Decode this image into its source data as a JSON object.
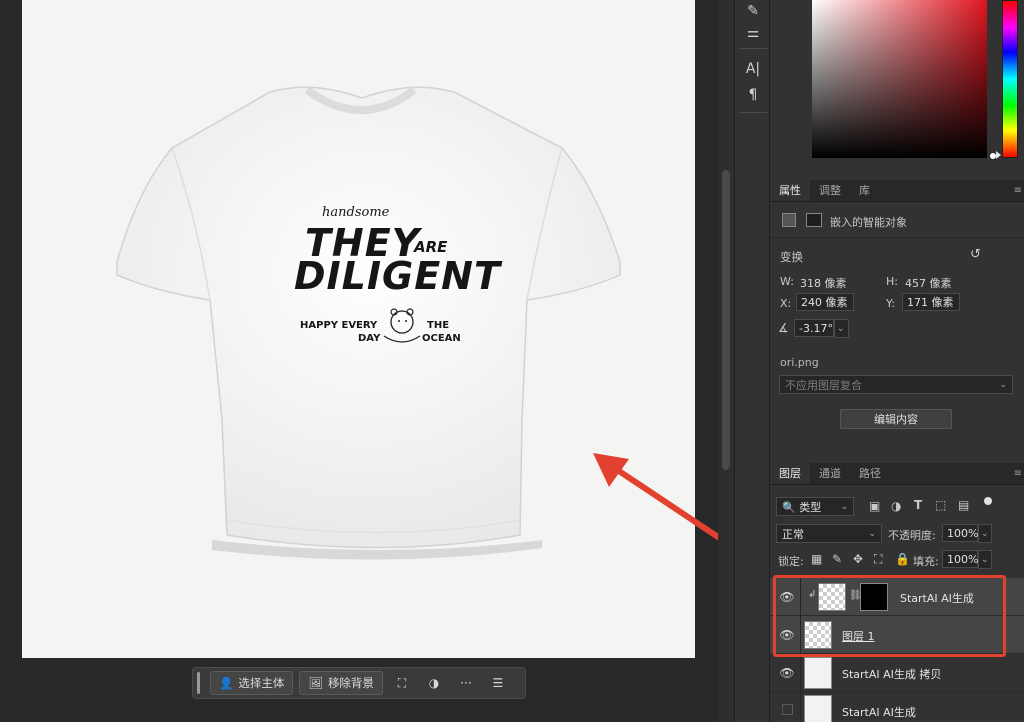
{
  "print": {
    "handsome": "handsome",
    "they": "THEY",
    "are": "ARE",
    "diligent": "DILIGENT",
    "happy_every": "HAPPY EVERY",
    "day": "DAY",
    "the": "THE",
    "ocean": "OCEAN"
  },
  "context_bar": {
    "select_subject": "选择主体",
    "remove_background": "移除背景",
    "more": "···"
  },
  "tools": {
    "type_tool": "A|",
    "paragraph_tool": "¶"
  },
  "properties": {
    "tabs": [
      "属性",
      "调整",
      "库"
    ],
    "object_type": "嵌入的智能对象",
    "transform_heading": "变换",
    "w_label": "W:",
    "w_value": "318 像素",
    "h_label": "H:",
    "h_value": "457 像素",
    "x_label": "X:",
    "x_value": "240 像素",
    "y_label": "Y:",
    "y_value": "171 像素",
    "angle_value": "-3.17°",
    "filename": "ori.png",
    "comp_placeholder": "不应用图层复合",
    "edit_contents": "编辑内容"
  },
  "layers": {
    "tabs": [
      "图层",
      "通道",
      "路径"
    ],
    "filter_kind": "类型",
    "blend_mode": "正常",
    "opacity_label": "不透明度:",
    "opacity_value": "100%",
    "lock_label": "锁定:",
    "fill_label": "填充:",
    "fill_value": "100%",
    "items": [
      {
        "name": "StartAI AI生成",
        "visible": true,
        "selected": true
      },
      {
        "name": "图层 1",
        "visible": true,
        "selected": true
      },
      {
        "name": "StartAI AI生成 拷贝",
        "visible": true,
        "selected": false
      },
      {
        "name": "StartAI AI生成",
        "visible": false,
        "selected": false
      }
    ]
  },
  "colors": {
    "annotation": "#e3412f",
    "hue": "#e0151f"
  }
}
